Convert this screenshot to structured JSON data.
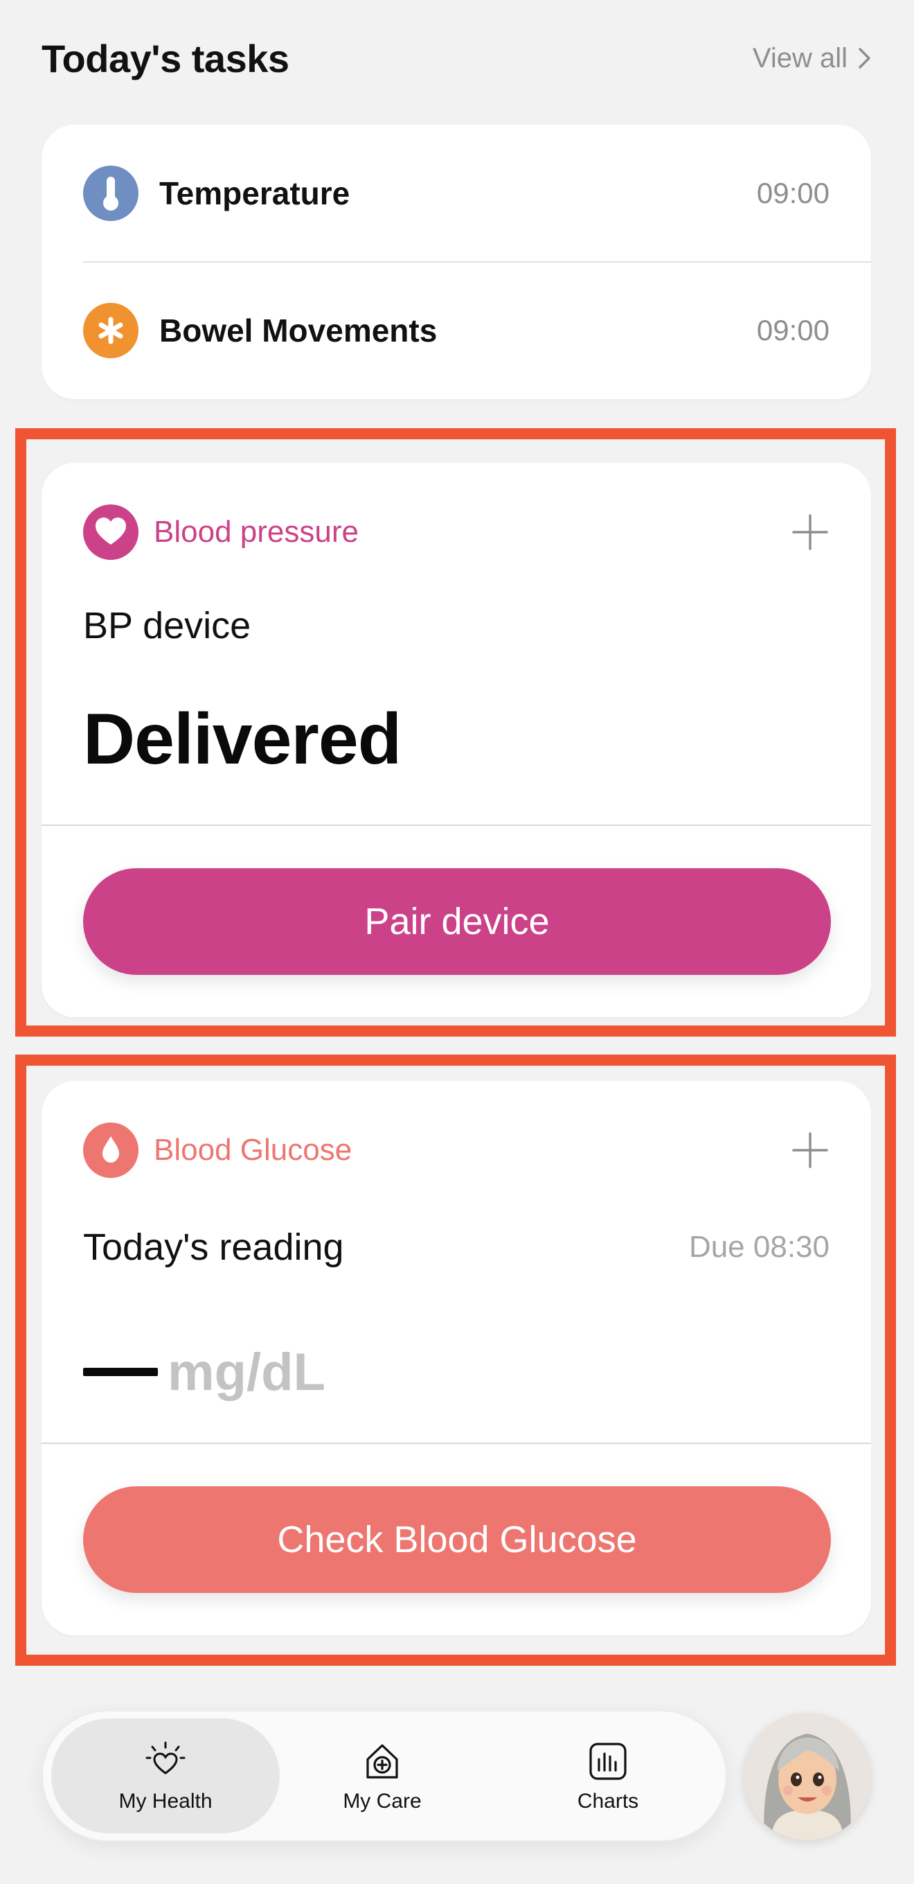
{
  "tasks": {
    "title": "Today's tasks",
    "view_all": "View all",
    "items": [
      {
        "label": "Temperature",
        "time": "09:00",
        "icon": "thermometer-icon",
        "color": "#6f8fc2"
      },
      {
        "label": "Bowel Movements",
        "time": "09:00",
        "icon": "asterisk-icon",
        "color": "#f0922f"
      }
    ]
  },
  "blood_pressure": {
    "title": "Blood pressure",
    "color": "#cc4289",
    "subtitle": "BP device",
    "status": "Delivered",
    "button": "Pair device"
  },
  "blood_glucose": {
    "title": "Blood Glucose",
    "color": "#ee7670",
    "subtitle": "Today's reading",
    "due": "Due 08:30",
    "unit": "mg/dL",
    "button": "Check Blood Glucose"
  },
  "highlight_color": "#ef5533",
  "nav": {
    "items": [
      {
        "label": "My Health",
        "icon": "heart-sun-icon",
        "active": true
      },
      {
        "label": "My Care",
        "icon": "house-plus-icon",
        "active": false
      },
      {
        "label": "Charts",
        "icon": "bar-chart-icon",
        "active": false
      }
    ]
  }
}
